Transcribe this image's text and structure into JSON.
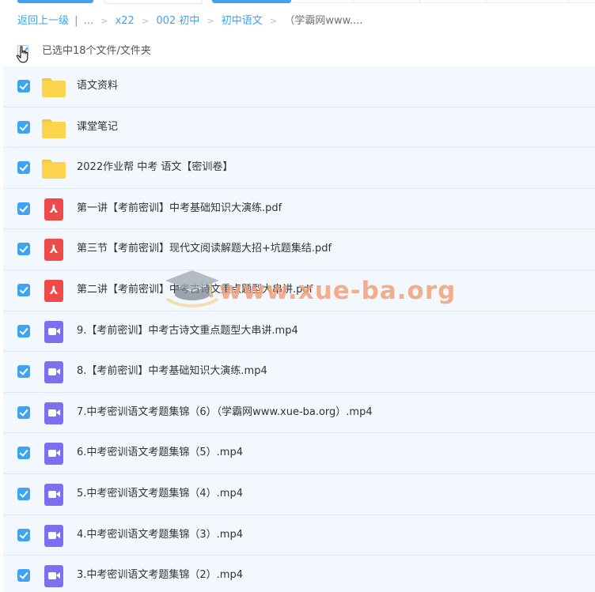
{
  "breadcrumb": {
    "back_label": "返回上一级",
    "divider": "|",
    "ellipsis": "...",
    "items": [
      "x22",
      "002 初中",
      "初中语文"
    ],
    "current": "（学霸网www...."
  },
  "selection": {
    "status_text": "已选中18个文件/文件夹"
  },
  "files": [
    {
      "name": "语文资料",
      "type": "folder"
    },
    {
      "name": "课堂笔记",
      "type": "folder"
    },
    {
      "name": "2022作业帮 中考 语文【密训卷】",
      "type": "folder"
    },
    {
      "name": "第一讲【考前密训】中考基础知识大演练.pdf",
      "type": "pdf"
    },
    {
      "name": "第三节【考前密训】现代文阅读解题大招+坑题集结.pdf",
      "type": "pdf"
    },
    {
      "name": "第二讲【考前密训】中考古诗文重点题型大串讲.pdf",
      "type": "pdf"
    },
    {
      "name": "9.【考前密训】中考古诗文重点题型大串讲.mp4",
      "type": "video"
    },
    {
      "name": "8.【考前密训】中考基础知识大演练.mp4",
      "type": "video"
    },
    {
      "name": "7.中考密训语文考题集锦（6）（学霸网www.xue-ba.org）.mp4",
      "type": "video"
    },
    {
      "name": "6.中考密训语文考题集锦（5）.mp4",
      "type": "video"
    },
    {
      "name": "5.中考密训语文考题集锦（4）.mp4",
      "type": "video"
    },
    {
      "name": "4.中考密训语文考题集锦（3）.mp4",
      "type": "video"
    },
    {
      "name": "3.中考密训语文考题集锦（2）.mp4",
      "type": "video"
    }
  ],
  "watermark": {
    "text": "www.xue-ba.org"
  },
  "colors": {
    "accent": "#3fa3ef",
    "folder": "#fcd34d",
    "pdf": "#ef4a4a",
    "video": "#7d6ff0",
    "row_bg": "#f2f8fe"
  }
}
